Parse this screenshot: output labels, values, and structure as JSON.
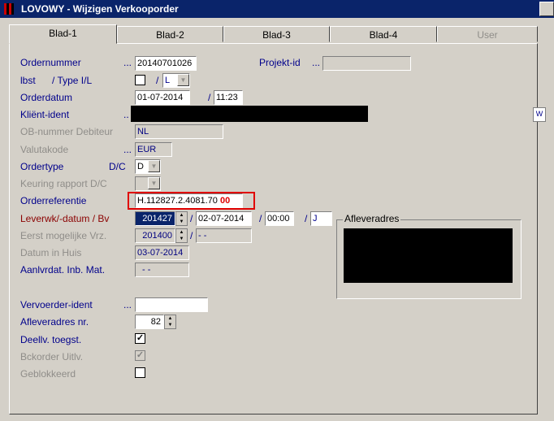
{
  "window": {
    "title": "LOVOWY - Wijzigen Verkooporder"
  },
  "tabs": [
    "Blad-1",
    "Blad-2",
    "Blad-3",
    "Blad-4",
    "User"
  ],
  "fields": {
    "ordernummer": {
      "label": "Ordernummer",
      "value": "20140701026"
    },
    "projekt_id": {
      "label": "Projekt-id",
      "value": ""
    },
    "lbst": {
      "label": "lbst",
      "type_label": "/ Type I/L",
      "type_value": "L"
    },
    "orderdatum": {
      "label": "Orderdatum",
      "date": "01-07-2014",
      "time": "11:23"
    },
    "klient_ident": {
      "label": "Kliënt-ident"
    },
    "ob_nummer": {
      "label": "OB-nummer Debiteur",
      "value": "NL"
    },
    "valutakode": {
      "label": "Valutakode",
      "value": "EUR"
    },
    "ordertype": {
      "label": "Ordertype",
      "dc_label": "D/C",
      "value": "D"
    },
    "keuring": {
      "label": "Keuring rapport D/C"
    },
    "orderreferentie": {
      "label": "Orderreferentie",
      "value": "H.112827.2.4081.70",
      "suffix": "00"
    },
    "leverwk": {
      "label": "Leverwk/-datum / Bv",
      "week": "201427",
      "date": "02-07-2014",
      "time": "00:00",
      "bv": "J"
    },
    "eerst": {
      "label": "Eerst mogelijke Vrz.",
      "week": "201400",
      "date": "- -"
    },
    "datum_huis": {
      "label": "Datum in Huis",
      "value": "03-07-2014"
    },
    "aanlvrdat": {
      "label": "Aanlvrdat. Inb. Mat.",
      "value": "- -"
    },
    "vervoerder": {
      "label": "Vervoerder-ident",
      "value": ""
    },
    "afleveradres_nr": {
      "label": "Afleveradres nr.",
      "value": "82"
    },
    "deellv": {
      "label": "Deellv. toegst.",
      "checked": true
    },
    "bckorder": {
      "label": "Bckorder Uitlv.",
      "checked": true
    },
    "geblokkeerd": {
      "label": "Geblokkeerd",
      "checked": false
    }
  },
  "afleveradres_group": {
    "label": "Afleveradres"
  },
  "colors": {
    "titlebar": "#0a246a",
    "label_blue": "#00008b",
    "label_red": "#8b0000",
    "highlight_box": "#e00000"
  }
}
